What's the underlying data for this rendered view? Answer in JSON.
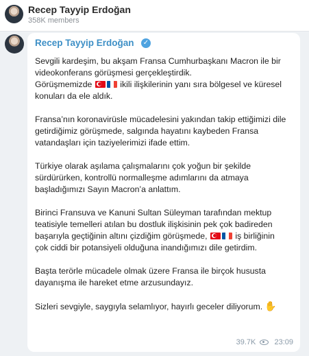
{
  "header": {
    "title": "Recep Tayyip Erdoğan",
    "subtitle": "358K members",
    "avatar_icon": "profile-photo"
  },
  "message": {
    "sender": "Recep Tayyip Erdoğan",
    "verified_icon": "verified-check",
    "paragraphs": [
      [
        "Sevgili kardeşim, bu akşam Fransa Cumhurbaşkanı Macron ile bir",
        "videokonferans görüşmesi gerçekleştirdik."
      ],
      [
        "Fransa’nın koronavirüsle mücadelesini yakından takip ettiğimizi dile",
        "getirdiğimiz görüşmede, salgında hayatını kaybeden Fransa",
        "vatandaşları için taziyelerimizi ifade ettim."
      ],
      [
        "Türkiye olarak aşılama çalışmalarını çok yoğun bir şekilde",
        "sürdürürken, kontrollü normalleşme adımlarını da atmaya",
        "başladığımızı Sayın Macron’a anlattım."
      ],
      [
        "Birinci Fransuva ve Kanuni Sultan Süleyman tarafından mektup",
        "teatisiyle temelleri atılan bu dostluk ilişkisinin pek çok badireden",
        "başarıyla geçtiğinin altını çizdiğim görüşmede,"
      ],
      [
        "Başta terörle mücadele olmak üzere Fransa ile birçok hususta",
        "dayanışma ile hareket etme arzusundayız."
      ],
      [
        "Sizleri sevgiyle, saygıyla selamlıyor, hayırlı geceler diliyorum."
      ]
    ],
    "p1_line3_prefix": "Görüşmemizde",
    "p1_line3_suffix": "ikili ilişkilerinin yanı sıra bölgesel ve küresel",
    "p1_line4": "konuları da ele aldık.",
    "p4_line3_suffix": "iş birliğinin",
    "p4_line4": "çok ciddi bir potansiyeli olduğuna inandığımızı dile getirdim.",
    "flags": [
      "turkey-flag",
      "france-flag"
    ],
    "emoji": "waving-hand",
    "views": "39.7K",
    "time": "23:09",
    "view_icon": "eye-icon"
  }
}
